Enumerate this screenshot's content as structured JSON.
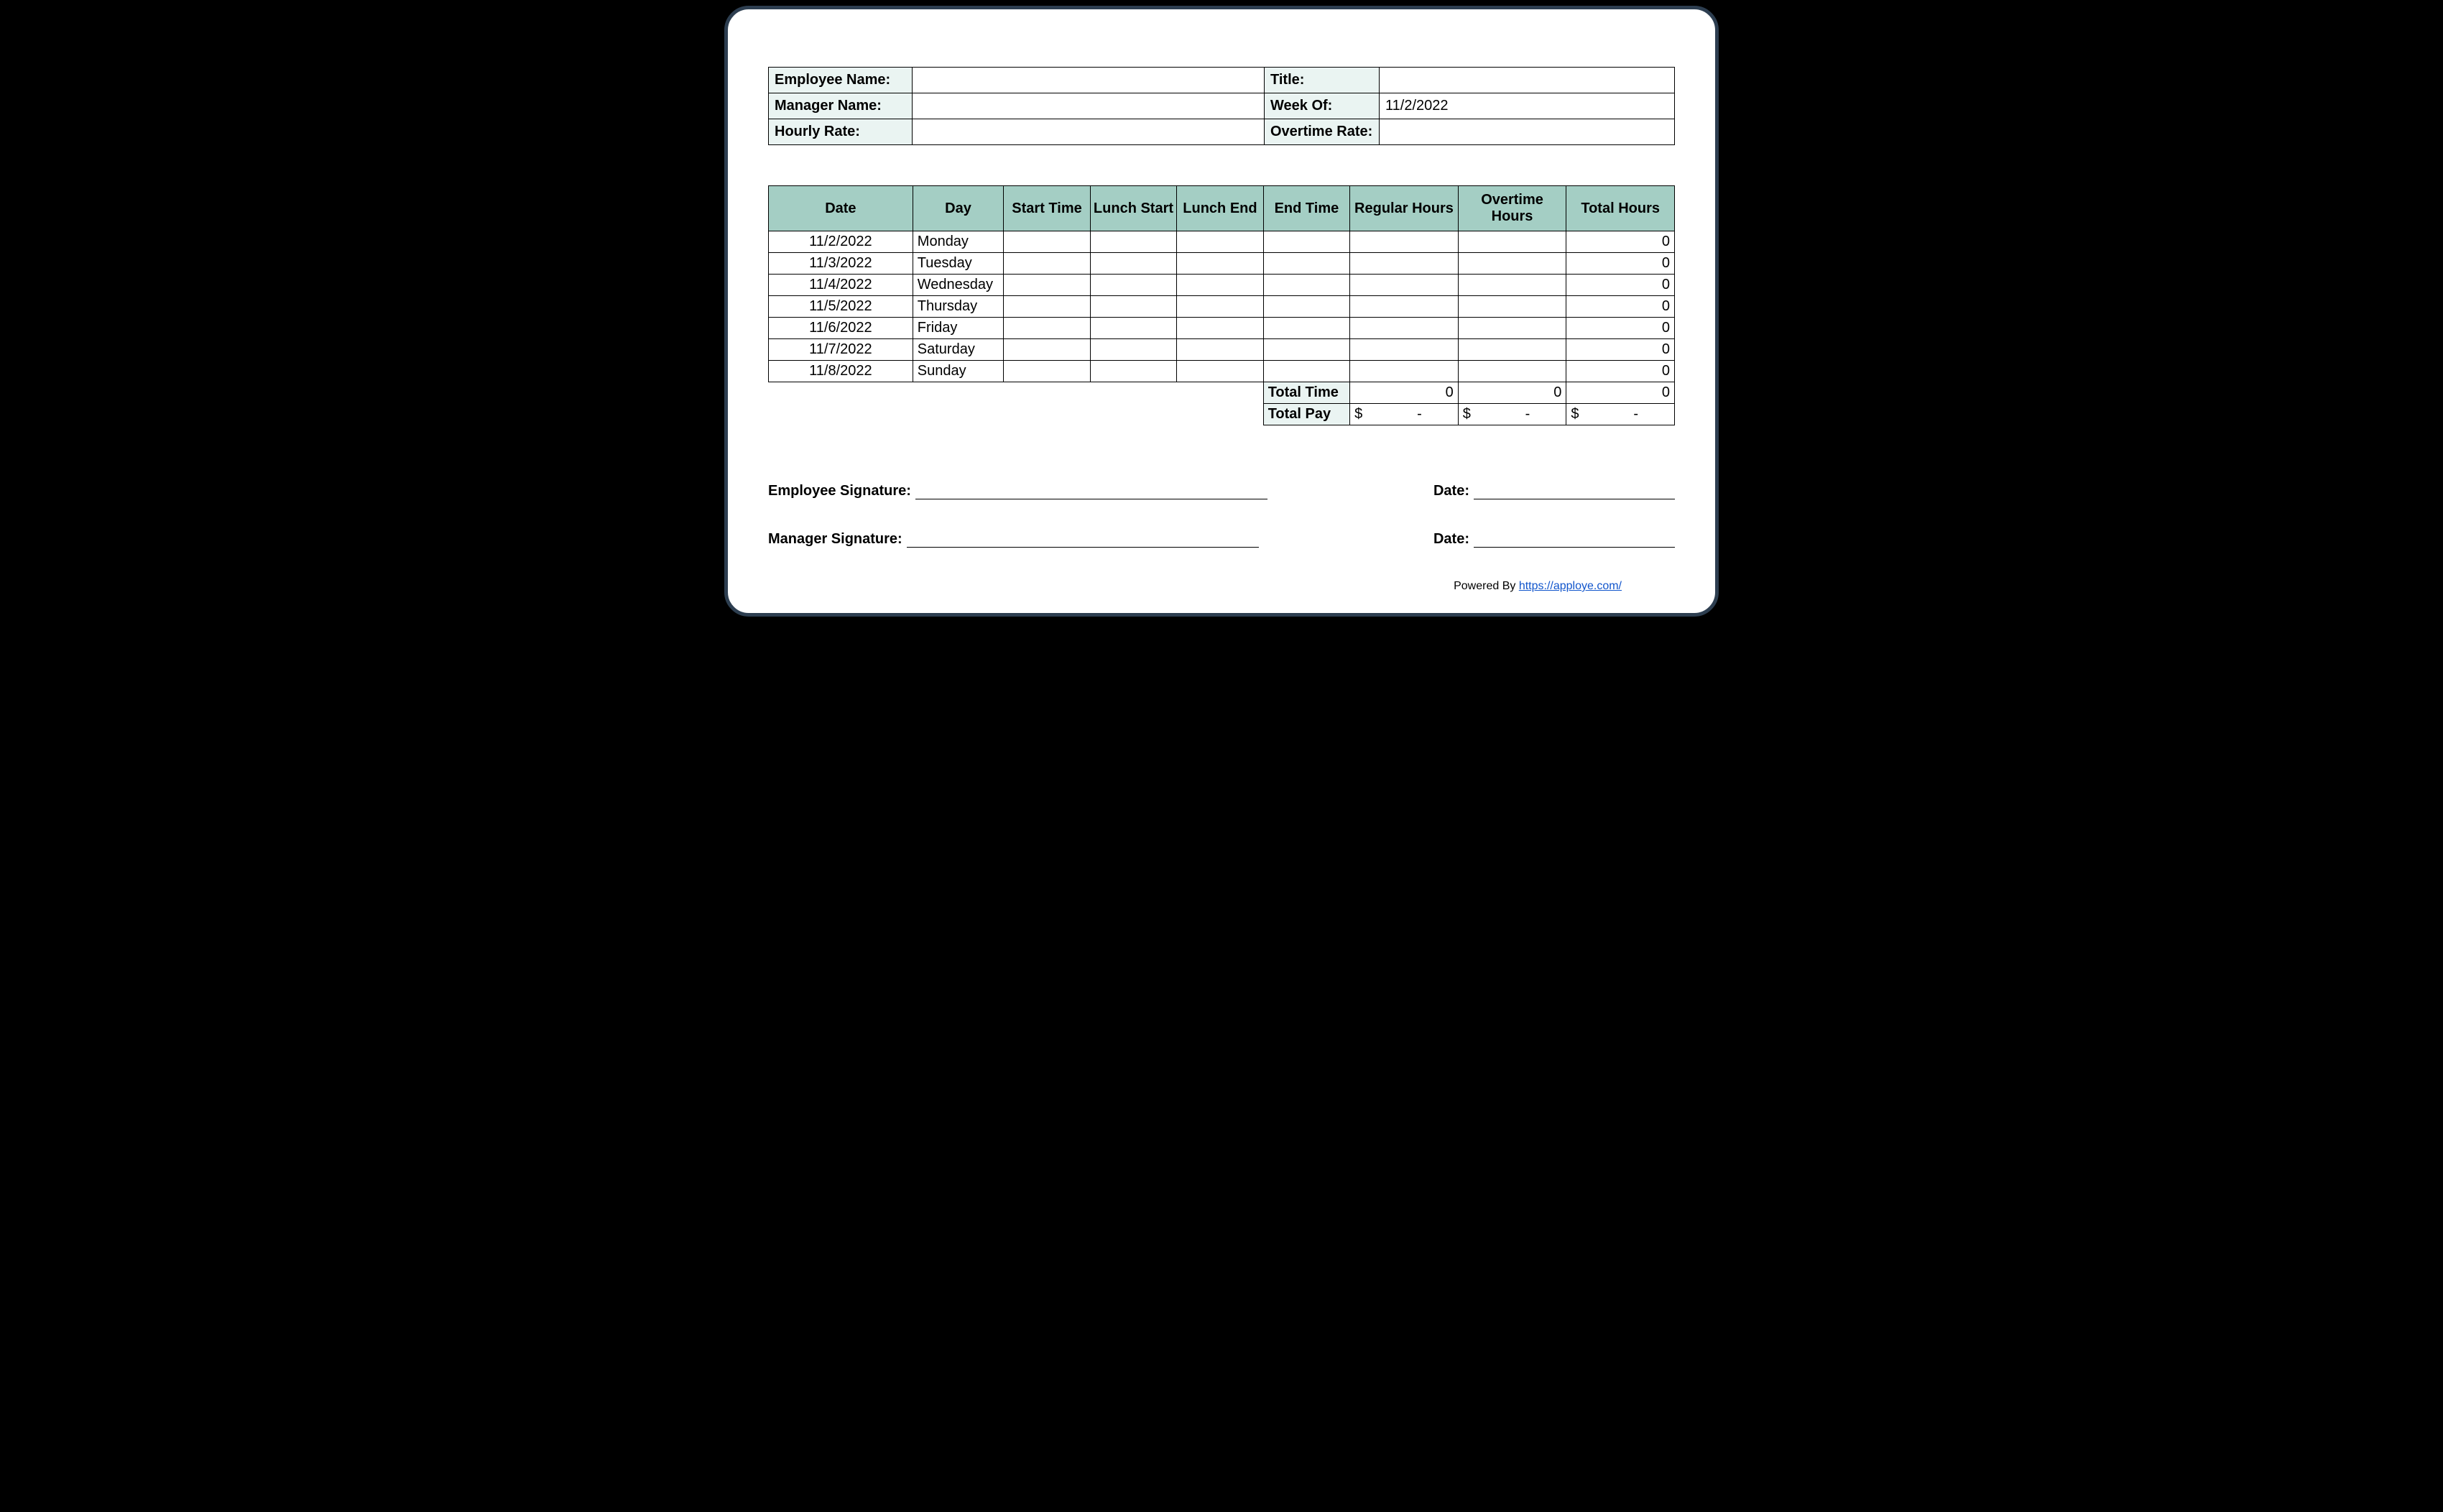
{
  "header": {
    "employee_name_label": "Employee Name:",
    "employee_name_value": "",
    "title_label": "Title:",
    "title_value": "",
    "manager_name_label": "Manager Name:",
    "manager_name_value": "",
    "week_of_label": "Week Of:",
    "week_of_value": "11/2/2022",
    "hourly_rate_label": "Hourly Rate:",
    "hourly_rate_value": "",
    "overtime_rate_label": "Overtime Rate:",
    "overtime_rate_value": ""
  },
  "columns": {
    "date": "Date",
    "day": "Day",
    "start_time": "Start Time",
    "lunch_start": "Lunch Start",
    "lunch_end": "Lunch End",
    "end_time": "End Time",
    "regular_hours": "Regular Hours",
    "overtime_hours": "Overtime Hours",
    "total_hours": "Total Hours"
  },
  "rows": [
    {
      "date": "11/2/2022",
      "day": "Monday",
      "start": "",
      "ls": "",
      "le": "",
      "end": "",
      "reg": "",
      "ot": "",
      "tot": "0"
    },
    {
      "date": "11/3/2022",
      "day": "Tuesday",
      "start": "",
      "ls": "",
      "le": "",
      "end": "",
      "reg": "",
      "ot": "",
      "tot": "0"
    },
    {
      "date": "11/4/2022",
      "day": "Wednesday",
      "start": "",
      "ls": "",
      "le": "",
      "end": "",
      "reg": "",
      "ot": "",
      "tot": "0"
    },
    {
      "date": "11/5/2022",
      "day": "Thursday",
      "start": "",
      "ls": "",
      "le": "",
      "end": "",
      "reg": "",
      "ot": "",
      "tot": "0"
    },
    {
      "date": "11/6/2022",
      "day": "Friday",
      "start": "",
      "ls": "",
      "le": "",
      "end": "",
      "reg": "",
      "ot": "",
      "tot": "0"
    },
    {
      "date": "11/7/2022",
      "day": "Saturday",
      "start": "",
      "ls": "",
      "le": "",
      "end": "",
      "reg": "",
      "ot": "",
      "tot": "0"
    },
    {
      "date": "11/8/2022",
      "day": "Sunday",
      "start": "",
      "ls": "",
      "le": "",
      "end": "",
      "reg": "",
      "ot": "",
      "tot": "0"
    }
  ],
  "totals": {
    "total_time_label": "Total Time",
    "total_time_reg": "0",
    "total_time_ot": "0",
    "total_time_tot": "0",
    "total_pay_label": "Total Pay",
    "currency": "$",
    "dash": "-"
  },
  "signatures": {
    "employee_label": "Employee Signature:",
    "manager_label": "Manager Signature:",
    "date_label": "Date:"
  },
  "footer": {
    "powered_by": "Powered By ",
    "link_text": "https://apploye.com/"
  }
}
